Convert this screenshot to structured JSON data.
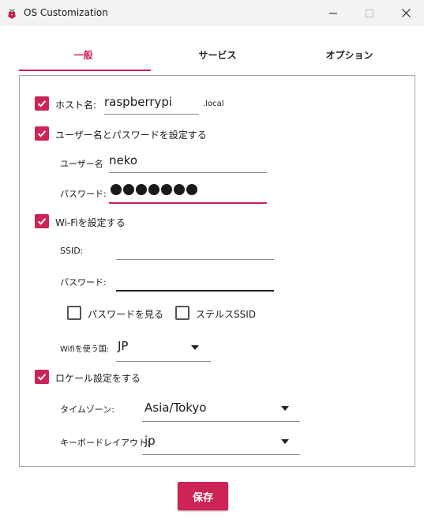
{
  "window": {
    "title": "OS Customization"
  },
  "tabs": [
    {
      "label": "一般",
      "active": true
    },
    {
      "label": "サービス",
      "active": false
    },
    {
      "label": "オプション",
      "active": false
    }
  ],
  "hostname": {
    "label": "ホスト名:",
    "value": "raspberrypi",
    "suffix": ".local",
    "checked": true
  },
  "user": {
    "toggle_label": "ユーザー名とパスワードを設定する",
    "checked": true,
    "username_label": "ユーザー名",
    "username_value": "neko",
    "password_label": "パスワード:",
    "password_masked_length": 7
  },
  "wifi": {
    "toggle_label": "Wi-Fiを設定する",
    "checked": true,
    "ssid_label": "SSID:",
    "ssid_value": "",
    "password_label": "パスワード:",
    "password_value": "",
    "show_password_label": "パスワードを見る",
    "show_password_checked": false,
    "hidden_ssid_label": "ステルスSSID",
    "hidden_ssid_checked": false,
    "country_label": "Wifiを使う国:",
    "country_value": "JP"
  },
  "locale": {
    "toggle_label": "ロケール設定をする",
    "checked": true,
    "timezone_label": "タイムゾーン:",
    "timezone_value": "Asia/Tokyo",
    "keyboard_label": "キーボードレイアウト:",
    "keyboard_value": "jp"
  },
  "actions": {
    "save_label": "保存"
  },
  "colors": {
    "accent": "#cd2355",
    "titlebar": "#f3f3f3",
    "panel_border": "#a8a8a8"
  }
}
